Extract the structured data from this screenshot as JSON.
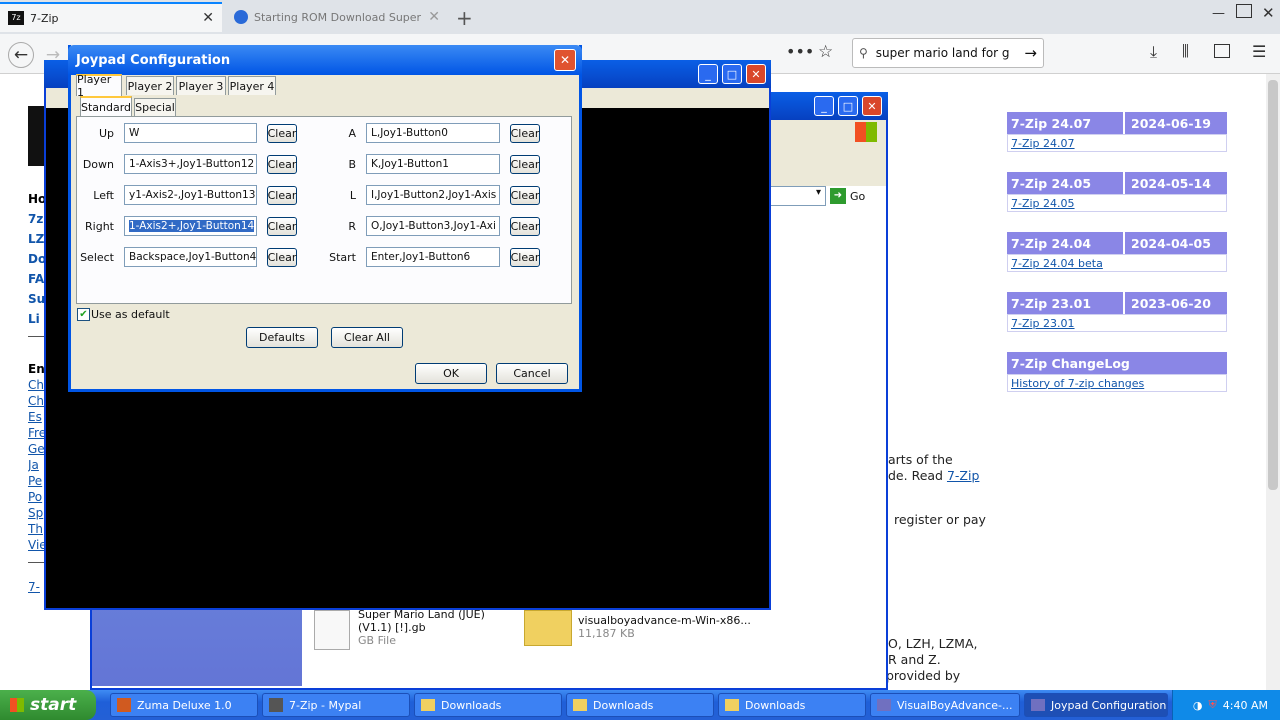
{
  "browser": {
    "tabs": [
      {
        "label": "7-Zip"
      },
      {
        "label": "Starting ROM Download Super Ma"
      }
    ],
    "search_value": "super mario land for g",
    "page_menu_icon": "ellipsis-icon"
  },
  "web": {
    "left_headings": [
      "Ho",
      "7z",
      "LZ",
      "Do",
      "FA",
      "Su",
      "Li"
    ],
    "left_links2": [
      "En",
      "Ch",
      "Ch",
      "Es",
      "Fre",
      "Ge",
      "Ja",
      "Pe",
      "Po",
      "Sp",
      "Th",
      "Vie"
    ],
    "left_bottom": "7-",
    "releases": [
      {
        "version": "7-Zip 24.07",
        "date": "2024-06-19",
        "link": "7-Zip 24.07"
      },
      {
        "version": "7-Zip 24.05",
        "date": "2024-05-14",
        "link": "7-Zip 24.05"
      },
      {
        "version": "7-Zip 24.04",
        "date": "2024-04-05",
        "link": "7-Zip 24.04 beta"
      },
      {
        "version": "7-Zip 23.01",
        "date": "2023-06-20",
        "link": "7-Zip 23.01"
      }
    ],
    "changelog": {
      "head": "7-Zip ChangeLog",
      "link": "History of 7-zip changes"
    },
    "frag1": "arts of the",
    "frag2_pre": "de. Read ",
    "frag2_link": "7-Zip",
    "frag3": "register or pay",
    "frag4": "O, LZH, LZMA,",
    "frag5": "R and Z.",
    "frag6": "provided by"
  },
  "explorer": {
    "go_label": "Go",
    "files": [
      {
        "name": "Super Mario Land (JUE) (V1.1) [!].gb",
        "type": "GB File"
      },
      {
        "name": "visualboyadvance-m-Win-x86...",
        "size": "11,187 KB"
      }
    ]
  },
  "dialog": {
    "title": "Joypad Configuration",
    "player_tabs": [
      "Player 1",
      "Player 2",
      "Player 3",
      "Player 4"
    ],
    "sub_tabs": [
      "Standard",
      "Special"
    ],
    "clear_label": "Clear",
    "left_keys": [
      {
        "label": "Up",
        "value": "W"
      },
      {
        "label": "Down",
        "value": "1-Axis3+,Joy1-Button12"
      },
      {
        "label": "Left",
        "value": "y1-Axis2-,Joy1-Button13"
      },
      {
        "label": "Right",
        "value": "1-Axis2+,Joy1-Button14"
      },
      {
        "label": "Select",
        "value": "Backspace,Joy1-Button4"
      }
    ],
    "right_keys": [
      {
        "label": "A",
        "value": "L,Joy1-Button0"
      },
      {
        "label": "B",
        "value": "K,Joy1-Button1"
      },
      {
        "label": "L",
        "value": "I,Joy1-Button2,Joy1-Axis"
      },
      {
        "label": "R",
        "value": "O,Joy1-Button3,Joy1-Axi"
      },
      {
        "label": "Start",
        "value": "Enter,Joy1-Button6"
      }
    ],
    "use_default_label": "Use as default",
    "use_default_checked": true,
    "defaults_label": "Defaults",
    "clear_all_label": "Clear All",
    "ok_label": "OK",
    "cancel_label": "Cancel"
  },
  "taskbar": {
    "start_label": "start",
    "tasks": [
      "Zuma Deluxe 1.0",
      "7-Zip - Mypal",
      "Downloads",
      "Downloads",
      "Downloads",
      "VisualBoyAdvance-...",
      "Joypad Configuration"
    ],
    "clock": "4:40 AM"
  }
}
